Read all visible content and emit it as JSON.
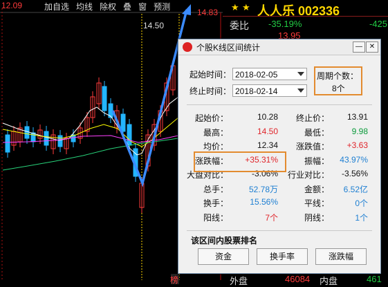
{
  "toolbar": {
    "price_left": "12.09",
    "items": [
      "加自选",
      "均线",
      "除权",
      "叠",
      "窗",
      "预测"
    ],
    "price_right": "14.83"
  },
  "chart_labels": {
    "crosshair_price": "14.50",
    "bottom_mark": "榜"
  },
  "right_panel": {
    "title": "人人乐 002336",
    "committee_label": "委比",
    "committee_value": "-35.19%",
    "committee_right": "-425",
    "row_value": "13.95",
    "outer_label": "外盘",
    "outer_value": "46084",
    "inner_label": "内盘",
    "inner_value": "461"
  },
  "dialog": {
    "title": "个股K线区间统计",
    "start_label": "起始时间：",
    "start_date": "2018-02-05",
    "end_label": "终止时间：",
    "end_date": "2018-02-14",
    "period_label": "周期个数：",
    "period_value": "8个",
    "stats": [
      {
        "l": "起始价：",
        "v": "10.28",
        "lc": "",
        "l2": "终止价：",
        "v2": "13.91",
        "c2": ""
      },
      {
        "l": "最高：",
        "v": "14.50",
        "lc": "red",
        "l2": "最低：",
        "v2": "9.98",
        "c2": "grn"
      },
      {
        "l": "均价：",
        "v": "12.34",
        "lc": "",
        "l2": "涨跌值：",
        "v2": "+3.63",
        "c2": "red"
      },
      {
        "l": "涨跌幅：",
        "v": "+35.31%",
        "lc": "red",
        "l2": "振幅：",
        "v2": "43.97%",
        "c2": "blu"
      },
      {
        "l": "大盘对比：",
        "v": "-3.06%",
        "lc": "",
        "l2": "行业对比：",
        "v2": "-3.56%",
        "c2": ""
      },
      {
        "l": "总手：",
        "v": "52.78万",
        "lc": "blu",
        "l2": "金额：",
        "v2": "6.52亿",
        "c2": "blu"
      },
      {
        "l": "换手：",
        "v": "15.56%",
        "lc": "blu",
        "l2": "平线：",
        "v2": "0个",
        "c2": "blu"
      },
      {
        "l": "阳线：",
        "v": "7个",
        "lc": "red",
        "l2": "阴线：",
        "v2": "1个",
        "c2": "blu"
      }
    ],
    "ranking_label": "该区间内股票排名",
    "buttons": [
      "资金",
      "换手率",
      "涨跌幅"
    ]
  }
}
